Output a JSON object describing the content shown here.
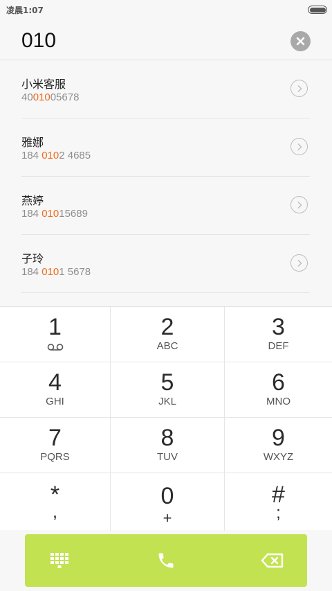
{
  "status_bar": {
    "time": "凌晨1:07"
  },
  "dialer": {
    "input_value": "010"
  },
  "results": [
    {
      "name": "小米客服",
      "number_parts": [
        "40",
        "010",
        "05678"
      ]
    },
    {
      "name": "雅娜",
      "number_parts": [
        "184 ",
        "010",
        "2 4685"
      ]
    },
    {
      "name": "燕婷",
      "number_parts": [
        "184 ",
        "010",
        "15689"
      ]
    },
    {
      "name": "子玲",
      "number_parts": [
        "184 ",
        "010",
        "1 5678"
      ]
    }
  ],
  "keypad": [
    {
      "digit": "1",
      "letters": ""
    },
    {
      "digit": "2",
      "letters": "ABC"
    },
    {
      "digit": "3",
      "letters": "DEF"
    },
    {
      "digit": "4",
      "letters": "GHI"
    },
    {
      "digit": "5",
      "letters": "JKL"
    },
    {
      "digit": "6",
      "letters": "MNO"
    },
    {
      "digit": "7",
      "letters": "PQRS"
    },
    {
      "digit": "8",
      "letters": "TUV"
    },
    {
      "digit": "9",
      "letters": "WXYZ"
    },
    {
      "digit": "*",
      "letters": ","
    },
    {
      "digit": "0",
      "letters": "+"
    },
    {
      "digit": "#",
      "letters": ";"
    }
  ],
  "icons": {
    "clear": "close-icon",
    "detail": "chevron-right-icon",
    "voicemail": "voicemail-icon",
    "dialpad": "dialpad-icon",
    "call": "phone-icon",
    "backspace": "backspace-icon"
  },
  "colors": {
    "accent": "#c3e251",
    "highlight": "#f26a1b"
  }
}
